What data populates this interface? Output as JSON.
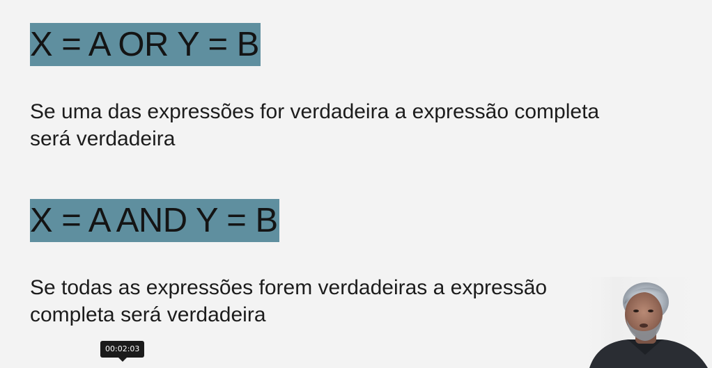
{
  "slide": {
    "expr_or": "X = A OR Y = B",
    "desc_or_line1": "Se uma das expressões for verdadeira a expressão completa",
    "desc_or_line2": "será verdadeira",
    "expr_and": "X = A AND Y = B",
    "desc_and_line1": "Se todas as expressões forem verdadeiras a expressão",
    "desc_and_line2": "completa será verdadeira"
  },
  "player": {
    "timestamp": "00:02:03"
  },
  "colors": {
    "highlight": "#5f8f9f",
    "background": "#f3f3f3",
    "text": "#1c1c1c"
  }
}
